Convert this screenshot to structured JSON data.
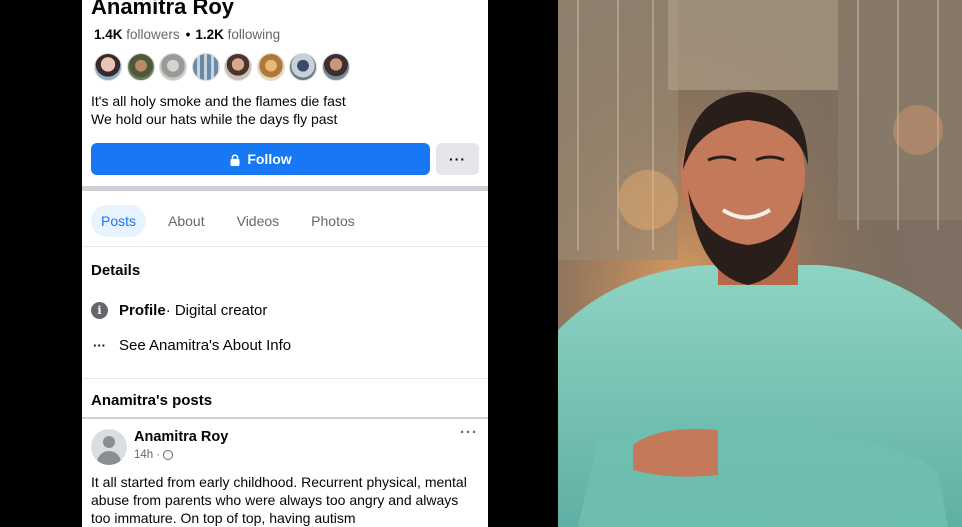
{
  "profile": {
    "name": "Anamitra Roy",
    "followers_count": "1.4K",
    "followers_label": "followers",
    "following_count": "1.2K",
    "following_label": "following",
    "bio_line1": "It's all holy smoke and the flames die fast",
    "bio_line2": "We hold our hats while the days fly past"
  },
  "actions": {
    "follow_label": "Follow",
    "more_label": "···"
  },
  "tabs": [
    {
      "label": "Posts",
      "active": true
    },
    {
      "label": "About",
      "active": false
    },
    {
      "label": "Videos",
      "active": false
    },
    {
      "label": "Photos",
      "active": false
    }
  ],
  "details": {
    "title": "Details",
    "profile_label": "Profile",
    "profile_sub": " · Digital creator",
    "about_link": "See Anamitra's About Info"
  },
  "posts_section": {
    "title": "Anamitra's posts"
  },
  "post": {
    "author": "Anamitra Roy",
    "time": "14h ·",
    "text": "It all started from early childhood. Recurrent physical, mental abuse from parents who were always too angry and always too immature. On top of top, having autism"
  },
  "colors": {
    "accent": "#1877f2",
    "tab_active_bg": "#e7f3ff",
    "secondary_text": "#65676b"
  },
  "icons": {
    "follow_icon": "lock-icon",
    "details_profile_icon": "info-icon",
    "details_about_icon": "ellipsis-icon",
    "post_privacy_icon": "globe-icon"
  }
}
